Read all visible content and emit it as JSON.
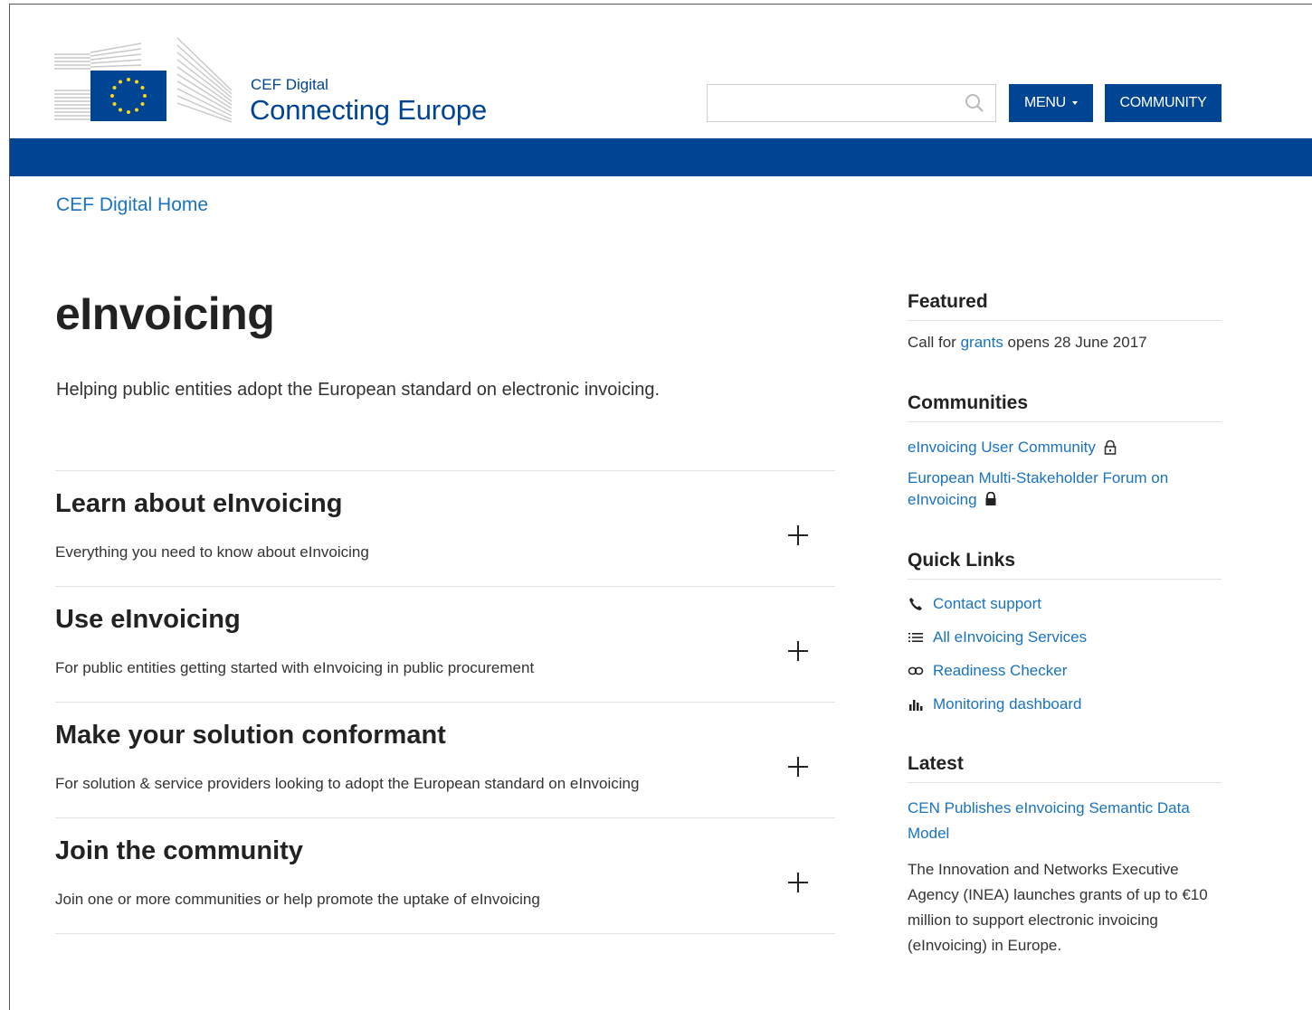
{
  "header": {
    "brand_small": "CEF Digital",
    "brand_big": "Connecting Europe",
    "search_placeholder": "",
    "menu_label": "MENU",
    "community_label": "COMMUNITY"
  },
  "breadcrumb": {
    "home": "CEF Digital Home"
  },
  "main": {
    "title": "eInvoicing",
    "intro": "Helping public entities adopt the European standard on electronic invoicing.",
    "sections": [
      {
        "title": "Learn about eInvoicing",
        "desc": "Everything you need to know about eInvoicing"
      },
      {
        "title": "Use eInvoicing",
        "desc": "For public entities getting started with eInvoicing in public procurement"
      },
      {
        "title": "Make your solution conformant",
        "desc": "For solution & service providers looking to adopt the European standard on eInvoicing"
      },
      {
        "title": "Join the community",
        "desc": "Join one or more communities or help promote the uptake of eInvoicing"
      }
    ]
  },
  "sidebar": {
    "featured": {
      "title": "Featured",
      "text_before": "Call for ",
      "link": "grants",
      "text_after": " opens 28 June 2017"
    },
    "communities": {
      "title": "Communities",
      "items": [
        {
          "label": "eInvoicing User Community"
        },
        {
          "label_line1": "European Multi-Stakeholder Forum on",
          "label_line2": "eInvoicing"
        }
      ]
    },
    "quick_links": {
      "title": "Quick Links",
      "items": [
        {
          "label": "Contact support",
          "icon": "phone-icon"
        },
        {
          "label": "All eInvoicing Services",
          "icon": "list-icon"
        },
        {
          "label": "Readiness Checker",
          "icon": "link-icon"
        },
        {
          "label": "Monitoring dashboard",
          "icon": "bar-chart-icon"
        }
      ]
    },
    "latest": {
      "title": "Latest",
      "headline": "CEN Publishes eInvoicing Semantic Data Model",
      "body": "The Innovation and Networks Executive Agency (INEA) launches grants of up to €10 million to support electronic invoicing (eInvoicing) in Europe."
    }
  },
  "colors": {
    "primary": "#004494",
    "link": "#1a73c1"
  }
}
